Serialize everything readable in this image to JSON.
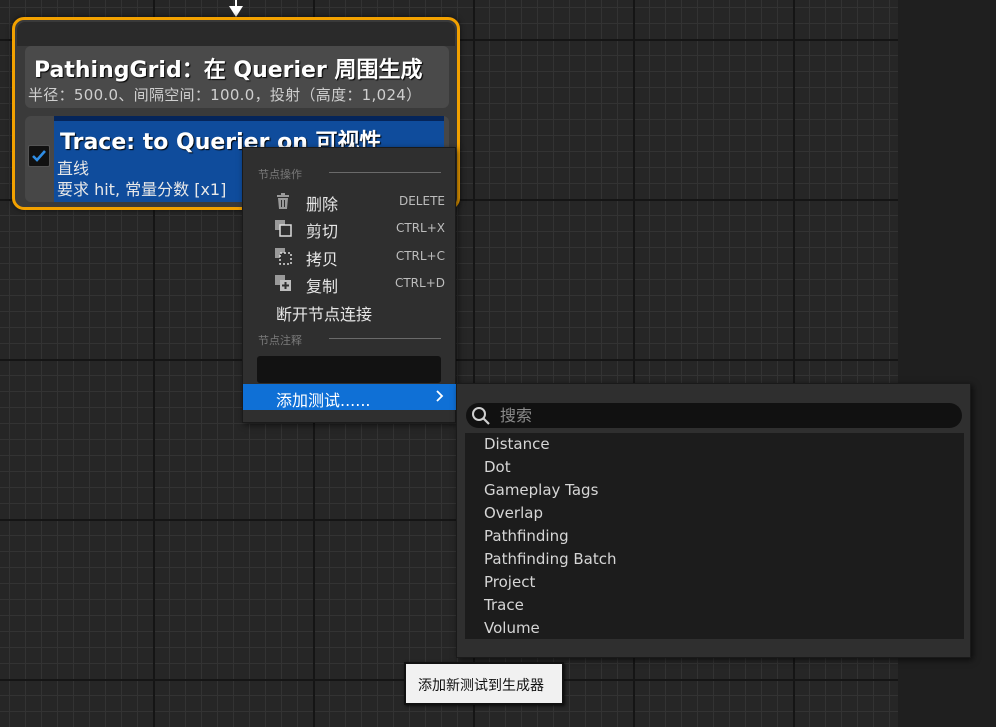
{
  "generator_node": {
    "title": "PathingGrid：在 Querier 周围生成",
    "subtitle": "半径：500.0、间隔空间：100.0，投射（高度：1,024）"
  },
  "test_node": {
    "title": "Trace: to Querier on 可视性",
    "line1": "直线",
    "line2": "要求 hit, 常量分数 [x1]",
    "checked": true
  },
  "context_menu": {
    "section_node_ops": "节点操作",
    "items": [
      {
        "label": "删除",
        "shortcut": "DELETE",
        "icon": "trash-icon"
      },
      {
        "label": "剪切",
        "shortcut": "CTRL+X",
        "icon": "cut-icon"
      },
      {
        "label": "拷贝",
        "shortcut": "CTRL+C",
        "icon": "copy-icon"
      },
      {
        "label": "复制",
        "shortcut": "CTRL+D",
        "icon": "duplicate-icon"
      }
    ],
    "break_links": "断开节点连接",
    "section_comment": "节点注释",
    "comment_value": "",
    "add_test": "添加测试......"
  },
  "submenu": {
    "search_placeholder": "搜索",
    "items": [
      "Distance",
      "Dot",
      "Gameplay Tags",
      "Overlap",
      "Pathfinding",
      "Pathfinding Batch",
      "Project",
      "Trace",
      "Volume"
    ]
  },
  "tooltip": {
    "text": "添加新测试到生成器"
  },
  "colors": {
    "node_border": "#f2a100",
    "test_block": "#0f4c9c",
    "highlight": "#0f70d6",
    "background": "#262626"
  }
}
